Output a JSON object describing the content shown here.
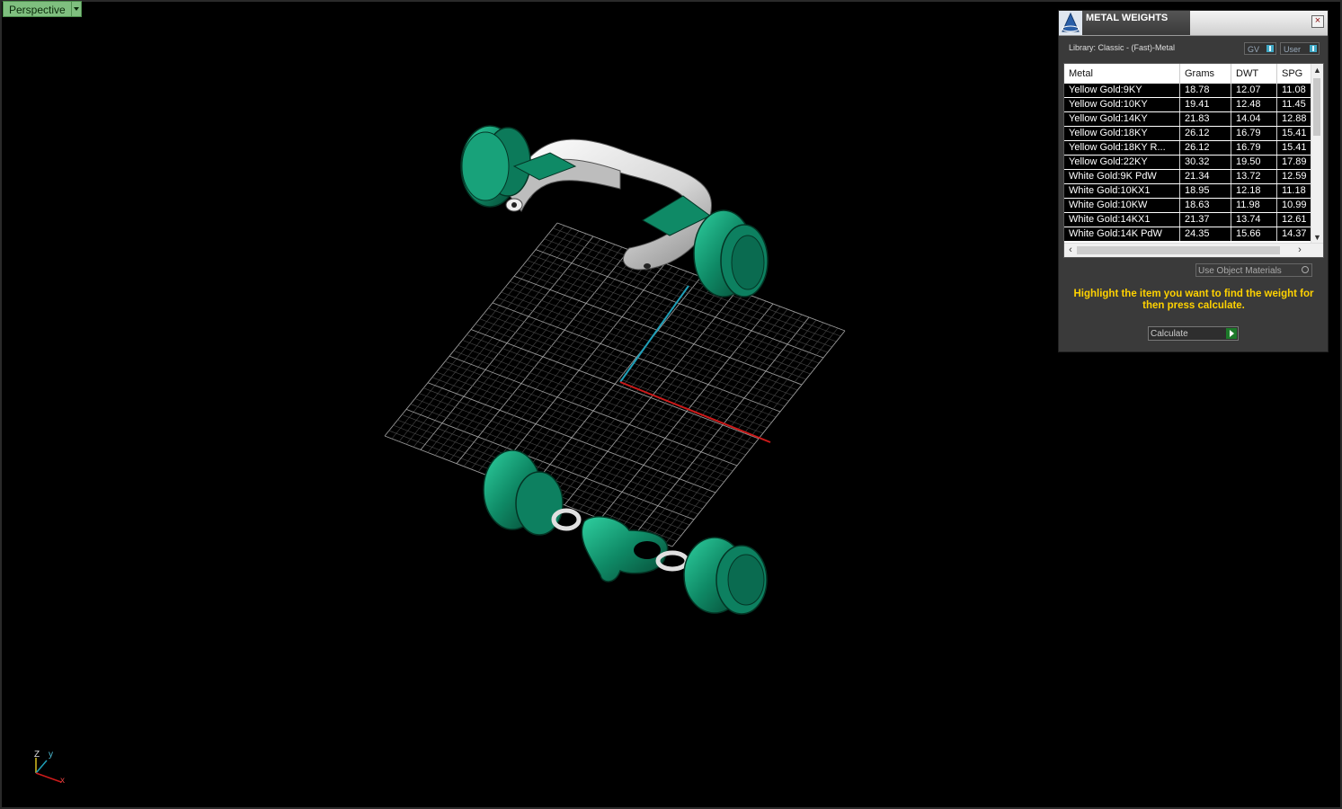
{
  "viewport": {
    "tab_label": "Perspective",
    "axis_labels": {
      "z": "Z",
      "y": "y",
      "x": "x"
    },
    "colors": {
      "model_green": "#0f8a66",
      "model_silver": "#d8d8d8",
      "x_axis": "#cc1a1a",
      "y_axis": "#1f9fb8",
      "grid": "#7a7a7a"
    }
  },
  "panel": {
    "title": "METAL WEIGHTS",
    "close_label": "×",
    "library": "Library: Classic - (Fast)-Metal",
    "toggle_gv": "GV",
    "toggle_user": "User",
    "columns": [
      "Metal",
      "Grams",
      "DWT",
      "SPG"
    ],
    "rows": [
      [
        "Yellow Gold:9KY",
        "18.78",
        "12.07",
        "11.08"
      ],
      [
        "Yellow Gold:10KY",
        "19.41",
        "12.48",
        "11.45"
      ],
      [
        "Yellow Gold:14KY",
        "21.83",
        "14.04",
        "12.88"
      ],
      [
        "Yellow Gold:18KY",
        "26.12",
        "16.79",
        "15.41"
      ],
      [
        "Yellow Gold:18KY R...",
        "26.12",
        "16.79",
        "15.41"
      ],
      [
        "Yellow Gold:22KY",
        "30.32",
        "19.50",
        "17.89"
      ],
      [
        "White Gold:9K PdW",
        "21.34",
        "13.72",
        "12.59"
      ],
      [
        "White Gold:10KX1",
        "18.95",
        "12.18",
        "11.18"
      ],
      [
        "White Gold:10KW",
        "18.63",
        "11.98",
        "10.99"
      ],
      [
        "White Gold:14KX1",
        "21.37",
        "13.74",
        "12.61"
      ],
      [
        "White Gold:14K PdW",
        "24.35",
        "15.66",
        "14.37"
      ]
    ],
    "use_object_materials": "Use Object Materials",
    "hint": "Highlight the item you want to find the weight for then press calculate.",
    "calculate_label": "Calculate"
  }
}
